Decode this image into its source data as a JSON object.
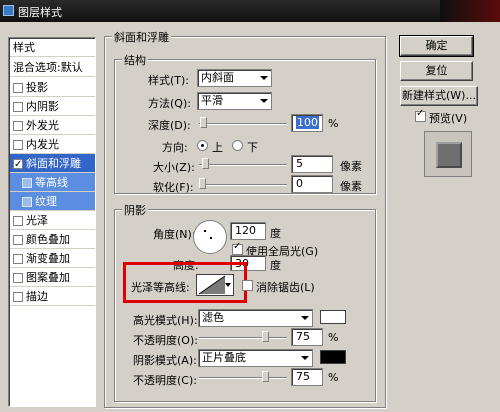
{
  "window": {
    "title": "图层样式"
  },
  "sidebar": {
    "header": "样式",
    "blend": "混合选项:默认",
    "items": [
      {
        "label": "投影",
        "checked": false
      },
      {
        "label": "内阴影",
        "checked": false
      },
      {
        "label": "外发光",
        "checked": false
      },
      {
        "label": "内发光",
        "checked": false
      },
      {
        "label": "斜面和浮雕",
        "checked": true,
        "selected": true
      },
      {
        "label": "等高线",
        "checked": false,
        "sub": true
      },
      {
        "label": "纹理",
        "checked": false,
        "sub": true
      },
      {
        "label": "光泽",
        "checked": false
      },
      {
        "label": "颜色叠加",
        "checked": false
      },
      {
        "label": "渐变叠加",
        "checked": false
      },
      {
        "label": "图案叠加",
        "checked": false
      },
      {
        "label": "描边",
        "checked": false
      }
    ]
  },
  "bevel": {
    "group_title": "斜面和浮雕",
    "structure_title": "结构",
    "style_label": "样式(T):",
    "style_value": "内斜面",
    "technique_label": "方法(Q):",
    "technique_value": "平滑",
    "depth_label": "深度(D):",
    "depth_value": "100",
    "depth_unit": "%",
    "depth_level": 0.0,
    "direction_label": "方向:",
    "direction_up": "上",
    "direction_down": "下",
    "size_label": "大小(Z):",
    "size_value": "5",
    "size_unit": "像素",
    "soften_label": "软化(F):",
    "soften_value": "0",
    "soften_unit": "像素"
  },
  "shading": {
    "title": "阴影",
    "angle_label": "角度(N):",
    "angle_value": "120",
    "angle_unit": "度",
    "global_light_label": "使用全局光(G)",
    "altitude_label": "高度:",
    "altitude_value": "30",
    "altitude_unit": "度",
    "gloss_contour_label": "光泽等高线:",
    "antialias_label": "消除锯齿(L)",
    "highlight_mode_label": "高光模式(H):",
    "highlight_mode_value": "滤色",
    "highlight_color": "#ffffff",
    "highlight_opacity_label": "不透明度(O):",
    "highlight_opacity_value": "75",
    "highlight_opacity_unit": "%",
    "shadow_mode_label": "阴影模式(A):",
    "shadow_mode_value": "正片叠底",
    "shadow_color": "#000000",
    "shadow_opacity_label": "不透明度(C):",
    "shadow_opacity_value": "75",
    "shadow_opacity_unit": "%"
  },
  "buttons": {
    "ok": "确定",
    "reset": "复位",
    "new_style": "新建样式(W)...",
    "preview_label": "预览(V)"
  },
  "colors": {
    "selected_bg": "#3265c8",
    "highlight_border": "#e00000"
  }
}
